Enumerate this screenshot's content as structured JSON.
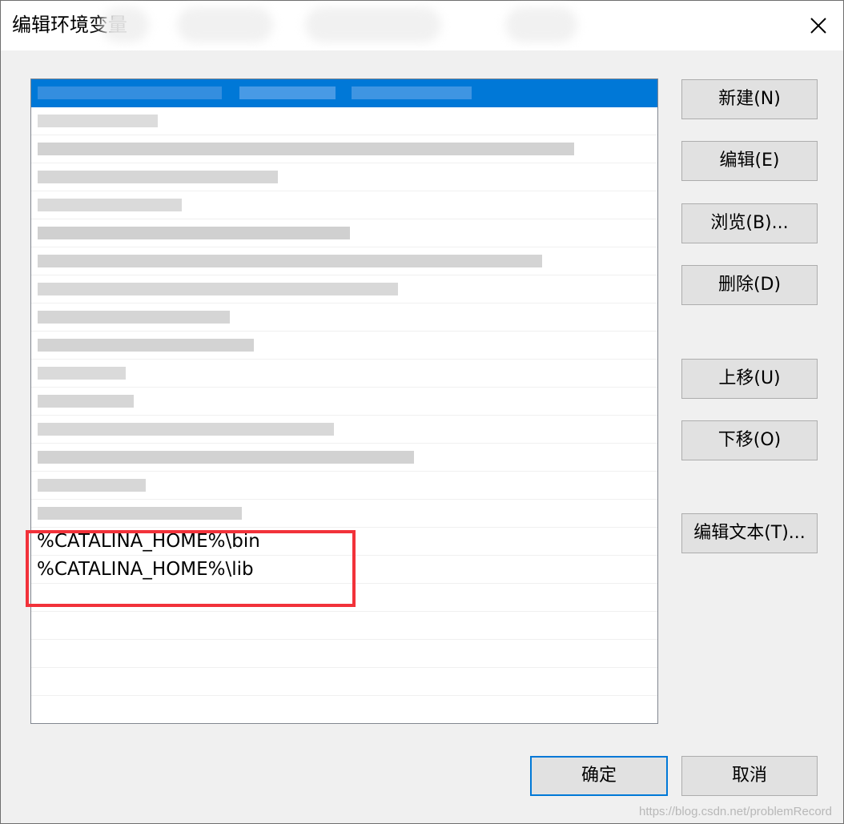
{
  "window": {
    "title": "编辑环境变量"
  },
  "list": {
    "visible_entries": [
      "%CATALINA_HOME%\\bin",
      "%CATALINA_HOME%\\lib"
    ]
  },
  "buttons": {
    "new": "新建(N)",
    "edit": "编辑(E)",
    "browse": "浏览(B)...",
    "delete": "删除(D)",
    "move_up": "上移(U)",
    "move_down": "下移(O)",
    "edit_text": "编辑文本(T)...",
    "ok": "确定",
    "cancel": "取消"
  },
  "watermark": "https://blog.csdn.net/problemRecord",
  "colors": {
    "selection": "#0078d7",
    "highlight_border": "#f2323a"
  }
}
